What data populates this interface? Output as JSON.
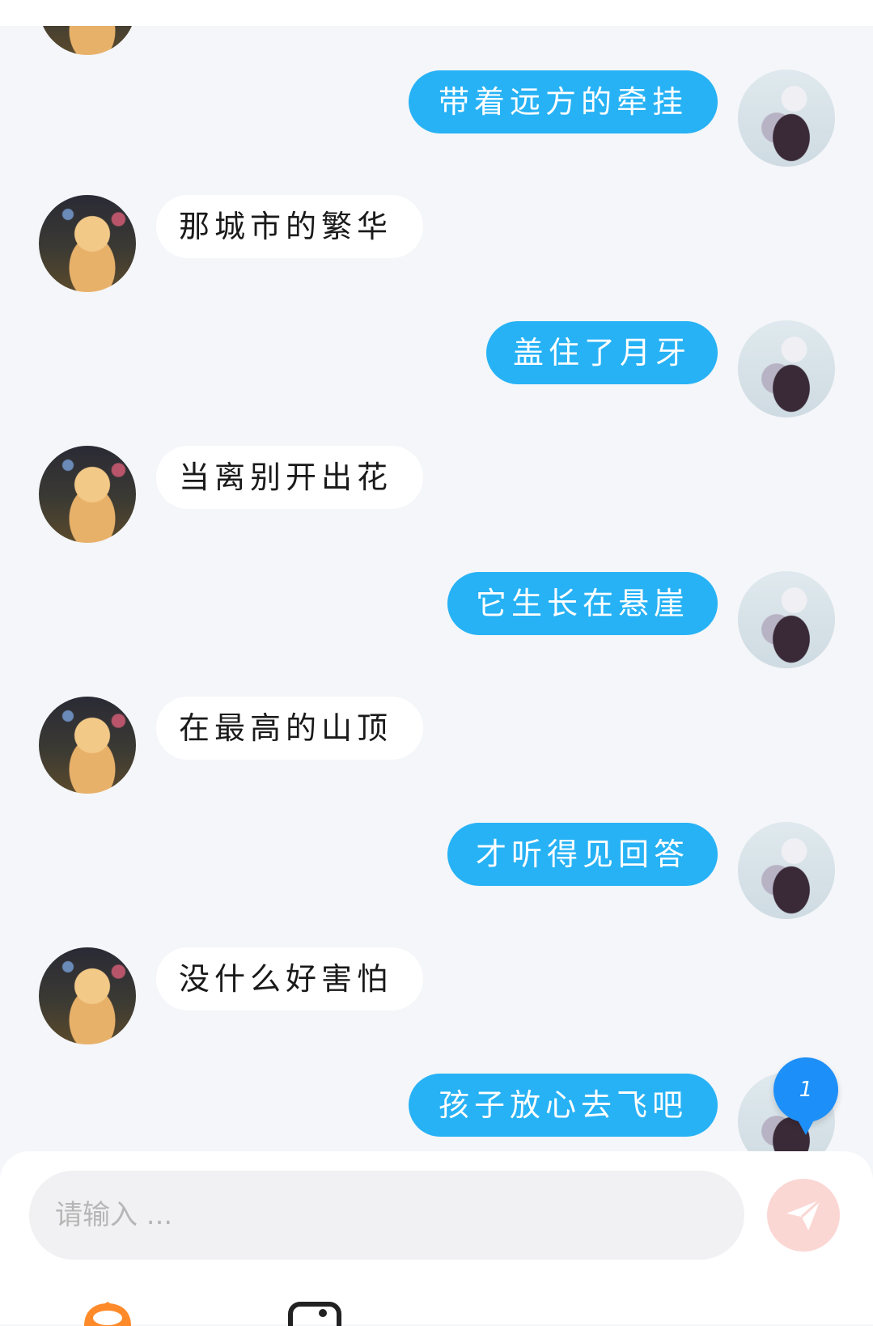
{
  "messages": [
    {
      "side": "self",
      "text": "带着远方的牵挂"
    },
    {
      "side": "other",
      "text": "那城市的繁华"
    },
    {
      "side": "self",
      "text": "盖住了月牙"
    },
    {
      "side": "other",
      "text": "当离别开出花"
    },
    {
      "side": "self",
      "text": "它生长在悬崖"
    },
    {
      "side": "other",
      "text": "在最高的山顶"
    },
    {
      "side": "self",
      "text": "才听得见回答"
    },
    {
      "side": "other",
      "text": "没什么好害怕"
    },
    {
      "side": "self",
      "text": "孩子放心去飞吧"
    }
  ],
  "unread_badge": "1",
  "composer": {
    "placeholder": "请输入 ..."
  },
  "colors": {
    "self_bubble": "#27b2f5",
    "other_bubble": "#ffffff",
    "send_button": "#fbd7d4",
    "badge": "#1d8ff8"
  },
  "icons": [
    "send-icon",
    "emoji-mascot-icon",
    "camera-icon"
  ]
}
